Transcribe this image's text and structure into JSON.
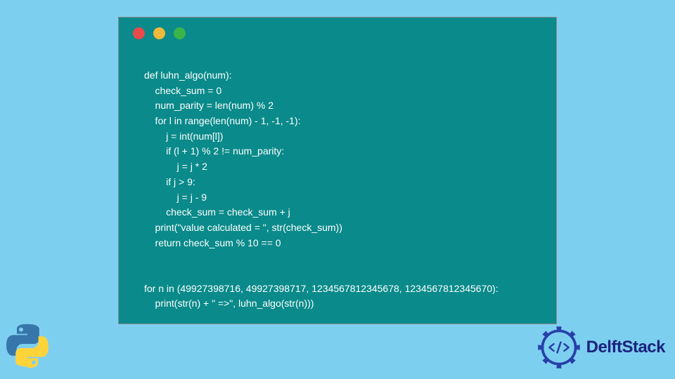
{
  "code": {
    "lines": [
      "def luhn_algo(num):",
      "    check_sum = 0",
      "    num_parity = len(num) % 2",
      "    for l in range(len(num) - 1, -1, -1):",
      "        j = int(num[l])",
      "        if (l + 1) % 2 != num_parity:",
      "            j = j * 2",
      "        if j > 9:",
      "            j = j - 9",
      "        check_sum = check_sum + j",
      "    print(\"value calculated = \", str(check_sum))",
      "    return check_sum % 10 == 0",
      "",
      "",
      "for n in (49927398716, 49927398717, 1234567812345678, 1234567812345670):",
      "    print(str(n) + \" =>\", luhn_algo(str(n)))"
    ]
  },
  "brand": {
    "name": "DelftStack"
  },
  "colors": {
    "bg": "#7dcff0",
    "window": "#0a8a8a",
    "dot_red": "#e94a4a",
    "dot_yellow": "#f0b93a",
    "dot_green": "#3bb54a",
    "brand_text": "#1a237e"
  }
}
